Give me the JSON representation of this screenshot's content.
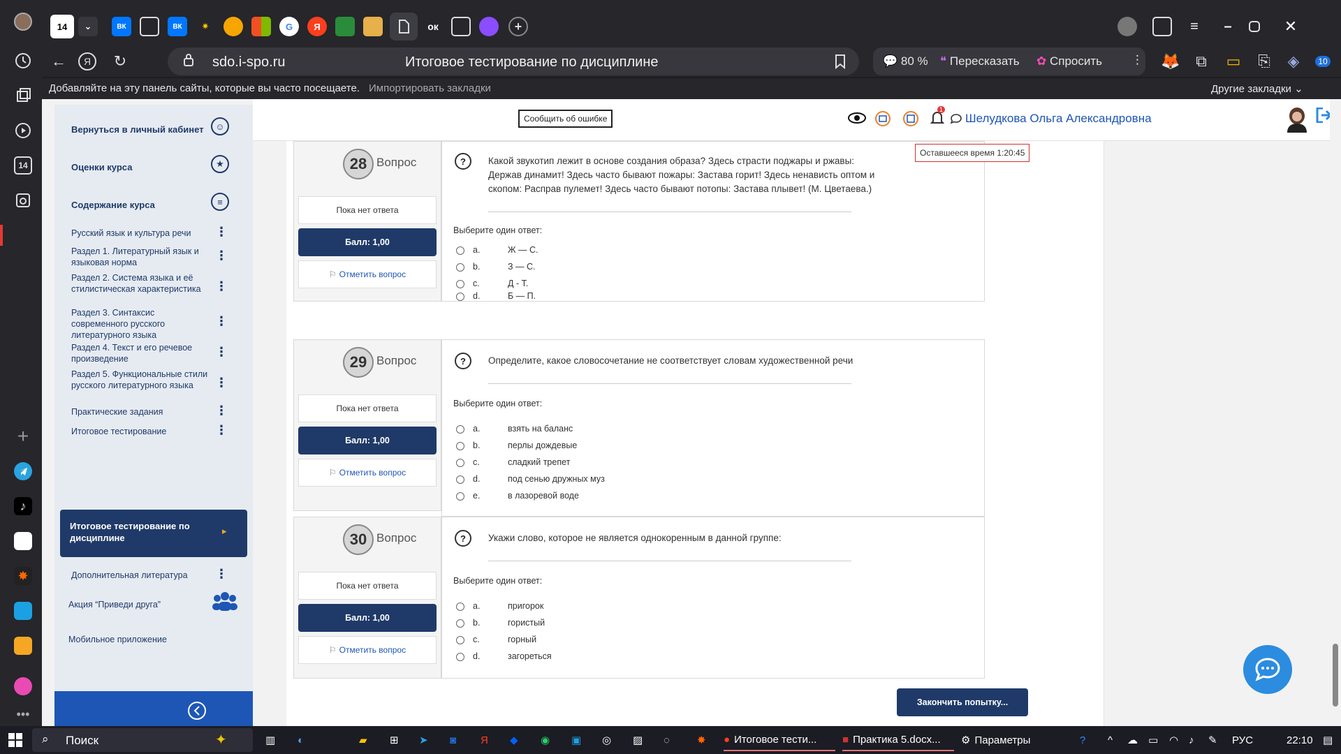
{
  "tabbar": {
    "tab_number": "14",
    "small_tab_labels": [
      "ВК",
      "Я",
      "ок"
    ]
  },
  "address": {
    "url": "sdo.i-spo.ru",
    "page_title": "Итоговое тестирование по дисциплине",
    "zoom": "80 %",
    "retell_label": "Пересказать",
    "ask_label": "Спросить",
    "ext_badge": "10"
  },
  "bookmarks": {
    "hint": "Добавляйте на эту панель сайты, которые вы часто посещаете.",
    "import_link": "Импортировать закладки",
    "other": "Другие закладки"
  },
  "rail": {
    "badge": "14"
  },
  "header": {
    "report_error": "Сообщить об ошибке",
    "notif_count": "1",
    "user_name": "Шелудкова Ольга Александровна"
  },
  "sidebar": {
    "back": "Вернуться в личный кабинет",
    "grades": "Оценки курса",
    "contents": "Содержание курса",
    "items": [
      "Русский язык и культура речи",
      "Раздел 1. Литературный язык и языковая норма",
      "Раздел 2. Система языка и её стилистическая характеристика",
      "Раздел 3. Синтаксис современного русского литературного языка",
      "Раздел 4. Текст и его речевое произведение",
      "Раздел 5. Функциональные стили русского литературного языка",
      "Практические задания",
      "Итоговое тестирование"
    ],
    "active": "Итоговое тестирование по дисциплине",
    "after_items": [
      "Дополнительная литература"
    ],
    "promo": "Акция “Приведи друга”",
    "mobile": "Мобильное приложение"
  },
  "timer": "Оставшееся время 1:20:45",
  "questions": [
    {
      "number": "28",
      "word": "Вопрос",
      "state": "Пока нет ответа",
      "grade": "Балл: 1,00",
      "flag": "Отметить вопрос",
      "text": "Какой звукотип лежит в основе создания образа? Здесь страсти поджары и ржавы: Держав динамит! Здесь часто бывают пожары: Застава горит! Здесь ненависть оптом и скопом: Расправ пулемет! Здесь часто бывают потопы: Застава плывет! (М. Цветаева.)",
      "prompt": "Выберите один ответ:",
      "options": [
        {
          "letter": "a.",
          "text": "Ж — С."
        },
        {
          "letter": "b.",
          "text": "З — С."
        },
        {
          "letter": "c.",
          "text": "Д - Т."
        },
        {
          "letter": "d.",
          "text": "Б — П."
        }
      ]
    },
    {
      "number": "29",
      "word": "Вопрос",
      "state": "Пока нет ответа",
      "grade": "Балл: 1,00",
      "flag": "Отметить вопрос",
      "text": "Определите, какое словосочетание не соответствует словам художественной речи",
      "prompt": "Выберите один ответ:",
      "options": [
        {
          "letter": "a.",
          "text": "взять на баланс"
        },
        {
          "letter": "b.",
          "text": "перлы дождевые"
        },
        {
          "letter": "c.",
          "text": "сладкий трепет"
        },
        {
          "letter": "d.",
          "text": "под сенью дружных муз"
        },
        {
          "letter": "e.",
          "text": "в лазоревой воде"
        }
      ]
    },
    {
      "number": "30",
      "word": "Вопрос",
      "state": "Пока нет ответа",
      "grade": "Балл: 1,00",
      "flag": "Отметить вопрос",
      "text": "Укажи слово, которое не является однокоренным в данной группе:",
      "prompt": "Выберите один ответ:",
      "options": [
        {
          "letter": "a.",
          "text": "пригорок"
        },
        {
          "letter": "b.",
          "text": "гористый"
        },
        {
          "letter": "c.",
          "text": "горный"
        },
        {
          "letter": "d.",
          "text": "загореться"
        }
      ]
    }
  ],
  "finish": "Закончить попытку...",
  "taskbar": {
    "search": "Поиск",
    "apps": [
      "Итоговое тести...",
      "Практика 5.docx...",
      "Параметры"
    ],
    "lang": "РУС",
    "time": "22:10"
  },
  "colors": {
    "brand_navy": "#1f3a68",
    "link_blue": "#1e56b5",
    "chat_blue": "#2b8ce0",
    "timer_border": "#cc3333"
  }
}
